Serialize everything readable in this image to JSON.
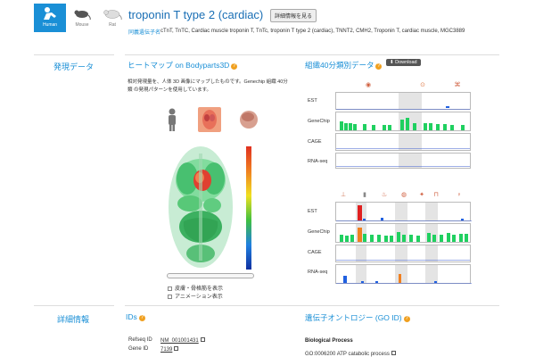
{
  "species": [
    {
      "name": "human",
      "label": "Human"
    },
    {
      "name": "mouse",
      "label": "Mouse"
    },
    {
      "name": "rat",
      "label": "Rat"
    }
  ],
  "header": {
    "title": "troponin T type 2 (cardiac)",
    "detail_button": "詳細情報を見る",
    "synonyms_label": "同義遺伝子名",
    "synonyms": "cTnT, TnTC, Cardiac muscle troponin T, TnTc, troponin T type 2 (cardiac), TNNT2, CMH2, Troponin T, cardiac muscle, MGC3889"
  },
  "sections": {
    "expression": "発現データ",
    "details": "詳細情報"
  },
  "heatmap": {
    "title": "ヒートマップ on Bodyparts3D",
    "description": "相対発現量を、人体 3D 画像にマップしたものです。Genechip 組織 40分類 の発現パターンを使用しています。",
    "checkbox_skin": "皮膚・骨格筋を表示",
    "checkbox_anim": "アニメーション表示",
    "colors": [
      "#e03020",
      "#f08020",
      "#f0e020",
      "#40c040",
      "#2080e0",
      "#1030a0"
    ]
  },
  "tissue": {
    "title": "組織40分類別データ",
    "download": "Download",
    "rows_top": [
      "EST",
      "GeneChip",
      "CAGE",
      "RNA-seq"
    ],
    "rows_bottom": [
      "EST",
      "GeneChip",
      "CAGE",
      "RNA-seq"
    ],
    "bar_color_high": "#e02020",
    "bar_color_mid": "#f08020",
    "bar_color_low": "#20d060",
    "bar_color_blue": "#2060e0"
  },
  "ids": {
    "title": "IDs",
    "refseq_label": "Refseq ID",
    "refseq_value": "NM_001001431",
    "gene_label": "Gene ID",
    "gene_value": "7139"
  },
  "go": {
    "title": "遺伝子オントロジー (GO ID)",
    "bp_title": "Biological Process",
    "item": "GO:0006200  ATP catabolic process"
  }
}
